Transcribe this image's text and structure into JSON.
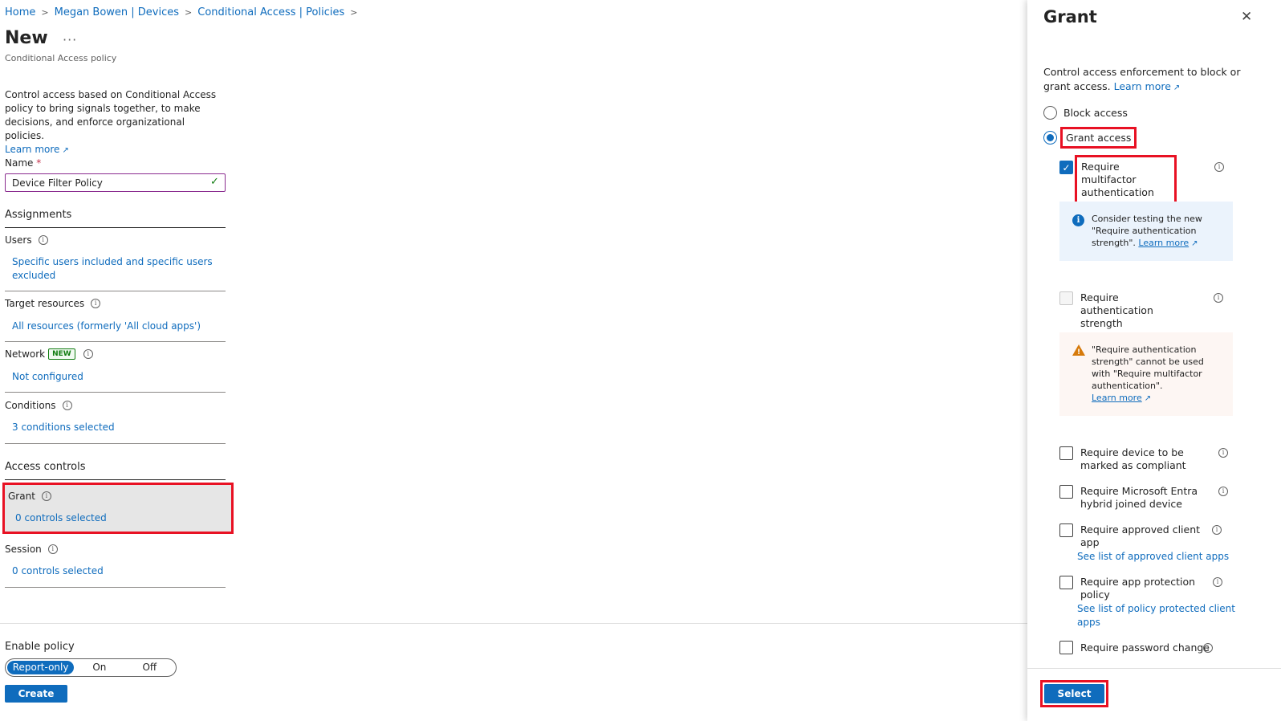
{
  "breadcrumb": [
    "Home",
    "Megan Bowen | Devices",
    "Conditional Access | Policies"
  ],
  "page": {
    "title": "New",
    "more": "···",
    "subtitle": "Conditional Access policy",
    "intro": "Control access based on Conditional Access policy to bring signals together, to make decisions, and enforce organizational policies.",
    "learn_more": "Learn more"
  },
  "name_field": {
    "label": "Name",
    "required_mark": "*",
    "value": "Device Filter Policy"
  },
  "assignments": {
    "heading": "Assignments",
    "users": {
      "label": "Users",
      "value": "Specific users included and specific users excluded"
    },
    "target_resources": {
      "label": "Target resources",
      "value": "All resources (formerly 'All cloud apps')"
    },
    "network": {
      "label": "Network",
      "badge": "NEW",
      "value": "Not configured"
    },
    "conditions": {
      "label": "Conditions",
      "value": "3 conditions selected"
    }
  },
  "access_controls": {
    "heading": "Access controls",
    "grant": {
      "label": "Grant",
      "value": "0 controls selected"
    },
    "session": {
      "label": "Session",
      "value": "0 controls selected"
    }
  },
  "enable_policy": {
    "label": "Enable policy",
    "options": [
      "Report-only",
      "On",
      "Off"
    ],
    "selected": "Report-only"
  },
  "create_label": "Create",
  "grant_panel": {
    "title": "Grant",
    "close": "✕",
    "description": "Control access enforcement to block or grant access.",
    "learn_more": "Learn more",
    "radio": {
      "block": "Block access",
      "grant": "Grant access",
      "selected": "grant"
    },
    "mfa": {
      "label": "Require multifactor authentication",
      "checked": true
    },
    "mfa_info": {
      "text": "Consider testing the new \"Require authentication strength\".",
      "link": "Learn more"
    },
    "auth_strength": {
      "label": "Require authentication strength",
      "checked": false
    },
    "auth_warning": {
      "text": "\"Require authentication strength\" cannot be used with \"Require multifactor authentication\".",
      "link": "Learn more"
    },
    "compliant": {
      "label": "Require device to be marked as compliant"
    },
    "hybrid": {
      "label": "Require Microsoft Entra hybrid joined device"
    },
    "approved_app": {
      "label": "Require approved client app",
      "link": "See list of approved client apps"
    },
    "app_protection": {
      "label": "Require app protection policy",
      "link": "See list of policy protected client apps"
    },
    "password_change": {
      "label": "Require password change"
    },
    "select_label": "Select"
  },
  "colors": {
    "accent": "#0f6cbd",
    "highlight": "#e81123",
    "warning": "#d67a0b",
    "success": "#107c10"
  }
}
